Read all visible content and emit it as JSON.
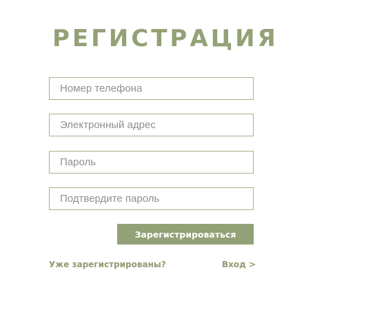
{
  "form": {
    "title": "РЕГИСТРАЦИЯ",
    "fields": [
      {
        "placeholder": "Номер телефона",
        "value": ""
      },
      {
        "placeholder": "Электронный адрес",
        "value": ""
      },
      {
        "placeholder": "Пароль",
        "value": ""
      },
      {
        "placeholder": "Подтвердите пароль",
        "value": ""
      }
    ],
    "submit_label": "Зарегистрироваться",
    "already_text": "Уже зарегистрированы?",
    "login_link": "Вход >"
  },
  "colors": {
    "accent": "#93a176",
    "border": "#a6b08c",
    "background": "#ffffff"
  }
}
